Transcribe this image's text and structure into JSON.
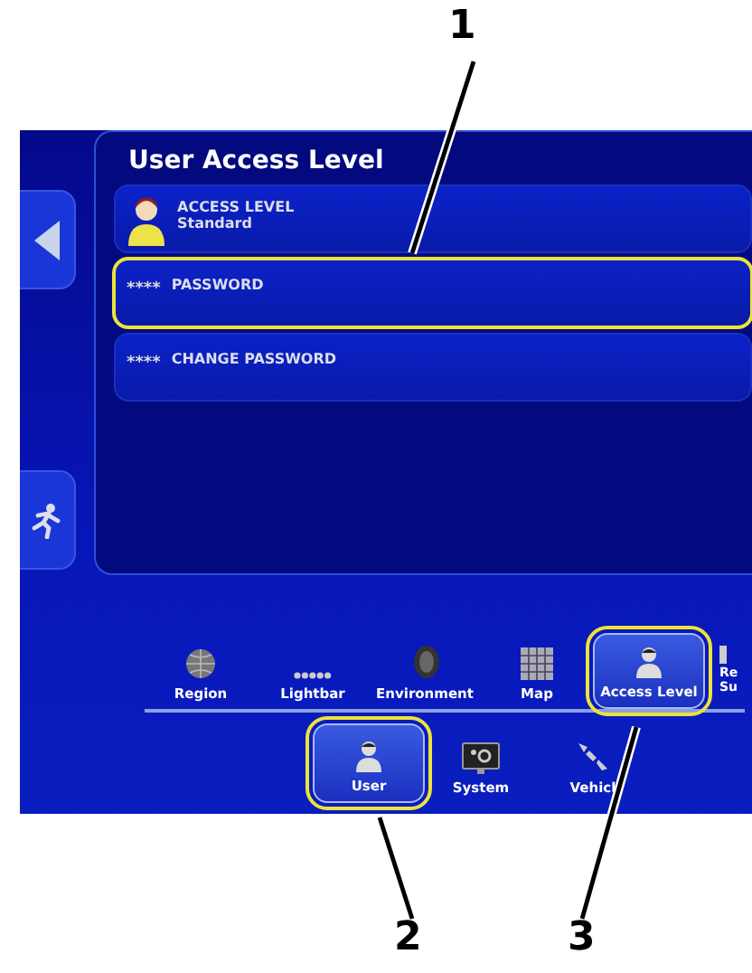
{
  "title": "User Access Level",
  "rows": [
    {
      "kind": "avatar",
      "label": "ACCESS LEVEL",
      "value": "Standard",
      "highlighted": false
    },
    {
      "kind": "masked",
      "mask": "****",
      "label": "PASSWORD",
      "highlighted": true
    },
    {
      "kind": "masked",
      "mask": "****",
      "label": "CHANGE PASSWORD",
      "highlighted": false
    }
  ],
  "nav_top": [
    {
      "label": "Region",
      "selected": false,
      "highlighted": false
    },
    {
      "label": "Lightbar",
      "selected": false,
      "highlighted": false
    },
    {
      "label": "Environment",
      "selected": false,
      "highlighted": false
    },
    {
      "label": "Map",
      "selected": false,
      "highlighted": false
    },
    {
      "label": "Access Level",
      "selected": true,
      "highlighted": true
    },
    {
      "label": "Re\nSu",
      "selected": false,
      "highlighted": false
    }
  ],
  "nav_bottom": [
    {
      "label": "User",
      "selected": true,
      "highlighted": true
    },
    {
      "label": "System",
      "selected": false,
      "highlighted": false
    },
    {
      "label": "Vehicl",
      "selected": false,
      "highlighted": false
    }
  ],
  "callouts": [
    {
      "label": "1"
    },
    {
      "label": "2"
    },
    {
      "label": "3"
    }
  ]
}
